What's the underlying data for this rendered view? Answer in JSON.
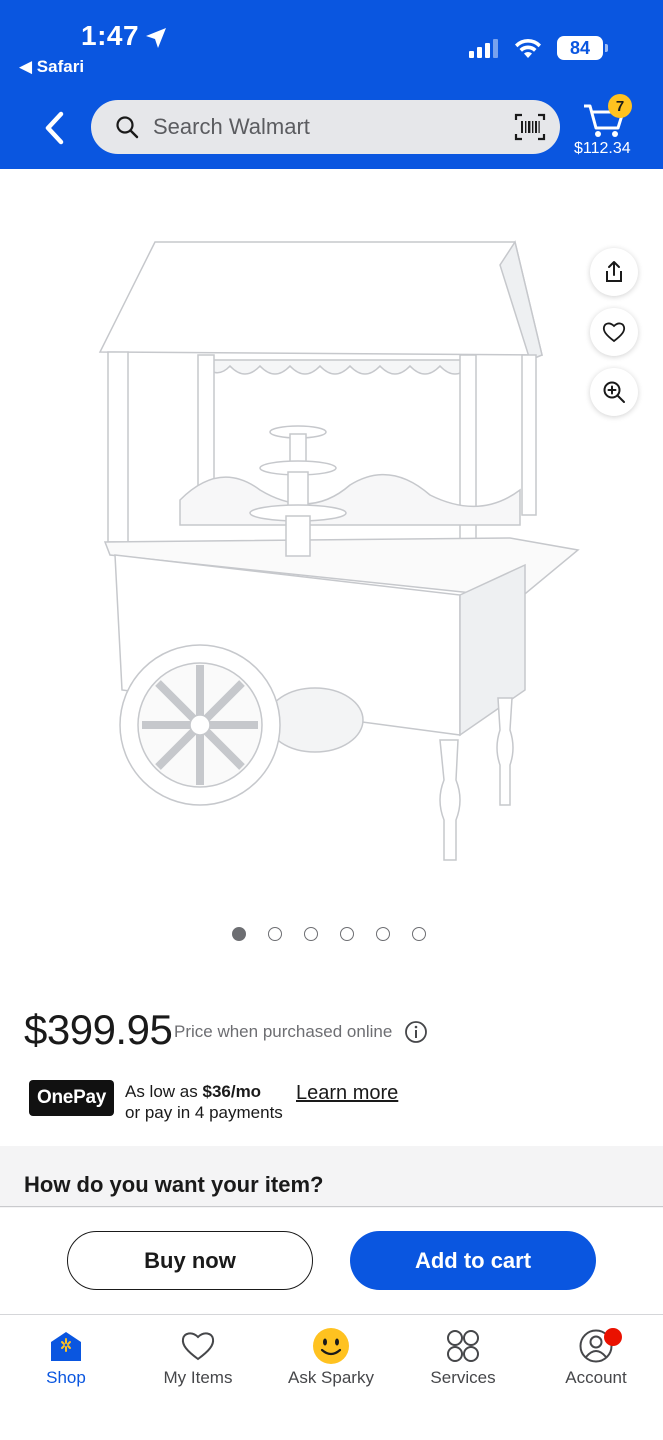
{
  "status_bar": {
    "time": "1:47",
    "back_app": "◀ Safari",
    "battery": "84"
  },
  "header": {
    "search_placeholder": "Search Walmart",
    "cart_count": "7",
    "cart_total": "$112.34"
  },
  "gallery": {
    "image_count": 6,
    "active_index": 0
  },
  "price": {
    "amount": "$399.95",
    "note": "Price when purchased online"
  },
  "onepay": {
    "logo": "OnePay",
    "line1_prefix": "As low as ",
    "line1_amount": "$36/mo",
    "line2": "or pay in 4 payments",
    "learn_more": "Learn more"
  },
  "section_title": "How do you want your item?",
  "actions": {
    "buy_now": "Buy now",
    "add_to_cart": "Add to cart"
  },
  "tabs": [
    {
      "label": "Shop",
      "icon": "home-icon",
      "active": true
    },
    {
      "label": "My Items",
      "icon": "heart-icon",
      "active": false
    },
    {
      "label": "Ask Sparky",
      "icon": "sparky-icon",
      "active": false
    },
    {
      "label": "Services",
      "icon": "services-icon",
      "active": false
    },
    {
      "label": "Account",
      "icon": "account-icon",
      "active": false
    }
  ],
  "colors": {
    "brand": "#0a56e0",
    "badge": "#ffc220",
    "alert": "#ea1100"
  }
}
